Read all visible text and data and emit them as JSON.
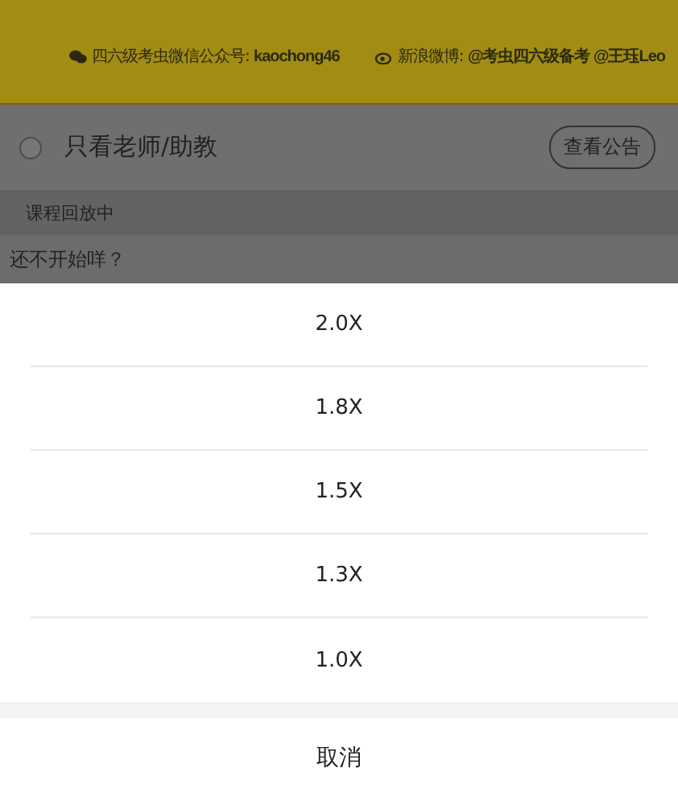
{
  "banner": {
    "items": [
      {
        "kind": "wechat",
        "text": "四六级考虫微信公众号: ",
        "bold": "kaochong46"
      },
      {
        "kind": "weibo",
        "text": "新浪微博: ",
        "bold": "@考虫四六级备考 @王珏Leo"
      }
    ]
  },
  "filter": {
    "label": "只看老师/助教",
    "checked": false,
    "button": "查看公告"
  },
  "status": "课程回放中",
  "message": "还不开始咩？",
  "speed_sheet": {
    "options": [
      "2.0X",
      "1.8X",
      "1.5X",
      "1.3X",
      "1.0X"
    ],
    "cancel": "取消"
  }
}
